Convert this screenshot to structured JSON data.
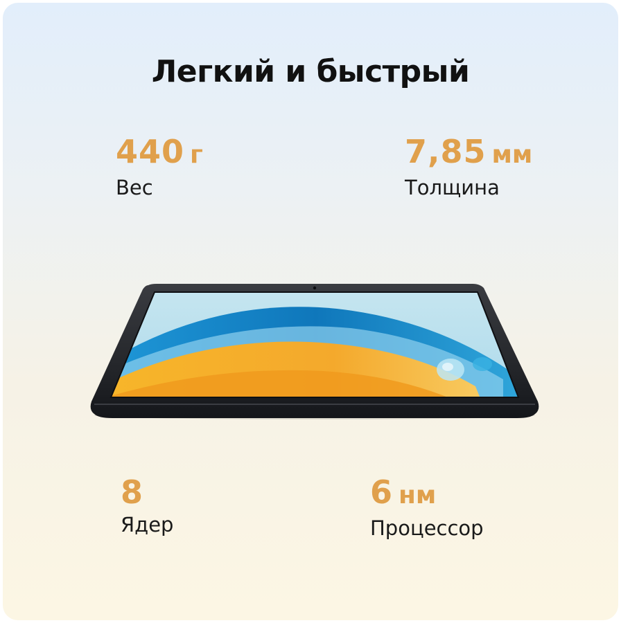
{
  "headline": "Легкий и быстрый",
  "stats": {
    "weight": {
      "value": "440",
      "unit": "г",
      "label": "Вес"
    },
    "thickness": {
      "value": "7,85",
      "unit": "мм",
      "label": "Толщина"
    },
    "cores": {
      "value": "8",
      "unit": "",
      "label": "Ядер"
    },
    "process": {
      "value": "6",
      "unit": "нм",
      "label": "Процессор"
    }
  },
  "colors": {
    "accent": "#e0a04c",
    "text": "#111111",
    "tablet_frame": "#2a2c30",
    "screen_sky": "#bfe3ee",
    "screen_orange": "#f4a92c",
    "screen_blue": "#1686c6"
  },
  "image": {
    "subject": "tablet-device-image"
  }
}
